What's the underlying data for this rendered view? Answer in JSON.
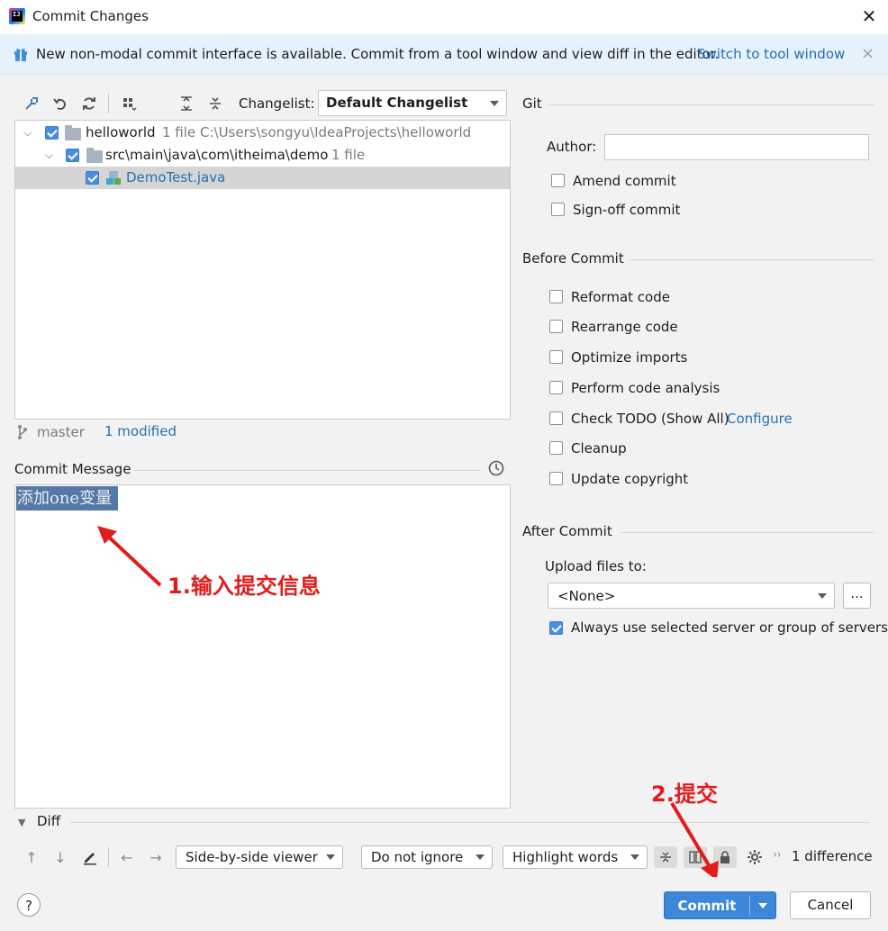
{
  "window": {
    "title": "Commit Changes",
    "close": "✕"
  },
  "banner": {
    "text": "New non-modal commit interface is available. Commit from a tool window and view diff in the editor.",
    "link": "Switch to tool window",
    "close": "×"
  },
  "toolbar": {
    "changelist_label": "Changelist:",
    "changelist_value": "Default Changelist"
  },
  "tree": {
    "root": {
      "name": "helloworld",
      "count": "1 file",
      "path": "C:\\Users\\songyu\\IdeaProjects\\helloworld"
    },
    "dir": {
      "name": "src\\main\\java\\com\\itheima\\demo",
      "count": "1 file"
    },
    "file": {
      "name": "DemoTest.java"
    }
  },
  "status": {
    "branch": "master",
    "modified": "1 modified"
  },
  "commit_message": {
    "label": "Commit Message",
    "text": "添加one变量"
  },
  "annotations": {
    "step1": "1.输入提交信息",
    "step2": "2.提交"
  },
  "git": {
    "section": "Git",
    "author_label": "Author:",
    "author_value": "",
    "amend": "Amend commit",
    "signoff": "Sign-off commit"
  },
  "before_commit": {
    "section": "Before Commit",
    "items": [
      "Reformat code",
      "Rearrange code",
      "Optimize imports",
      "Perform code analysis",
      "Check TODO (Show All)",
      "Cleanup",
      "Update copyright"
    ],
    "configure_link": "Configure"
  },
  "after_commit": {
    "section": "After Commit",
    "upload_label": "Upload files to:",
    "upload_value": "<None>",
    "browse": "...",
    "always_use": "Always use selected server or group of servers"
  },
  "diff": {
    "section": "Diff",
    "viewer": "Side-by-side viewer",
    "ignore": "Do not ignore",
    "highlight": "Highlight words",
    "count": "1 difference"
  },
  "buttons": {
    "help": "?",
    "commit": "Commit",
    "cancel": "Cancel"
  },
  "colors": {
    "accent": "#3c87d8",
    "link": "#2470b3",
    "annotation": "#e21c1c",
    "selection": "#5579a6"
  }
}
